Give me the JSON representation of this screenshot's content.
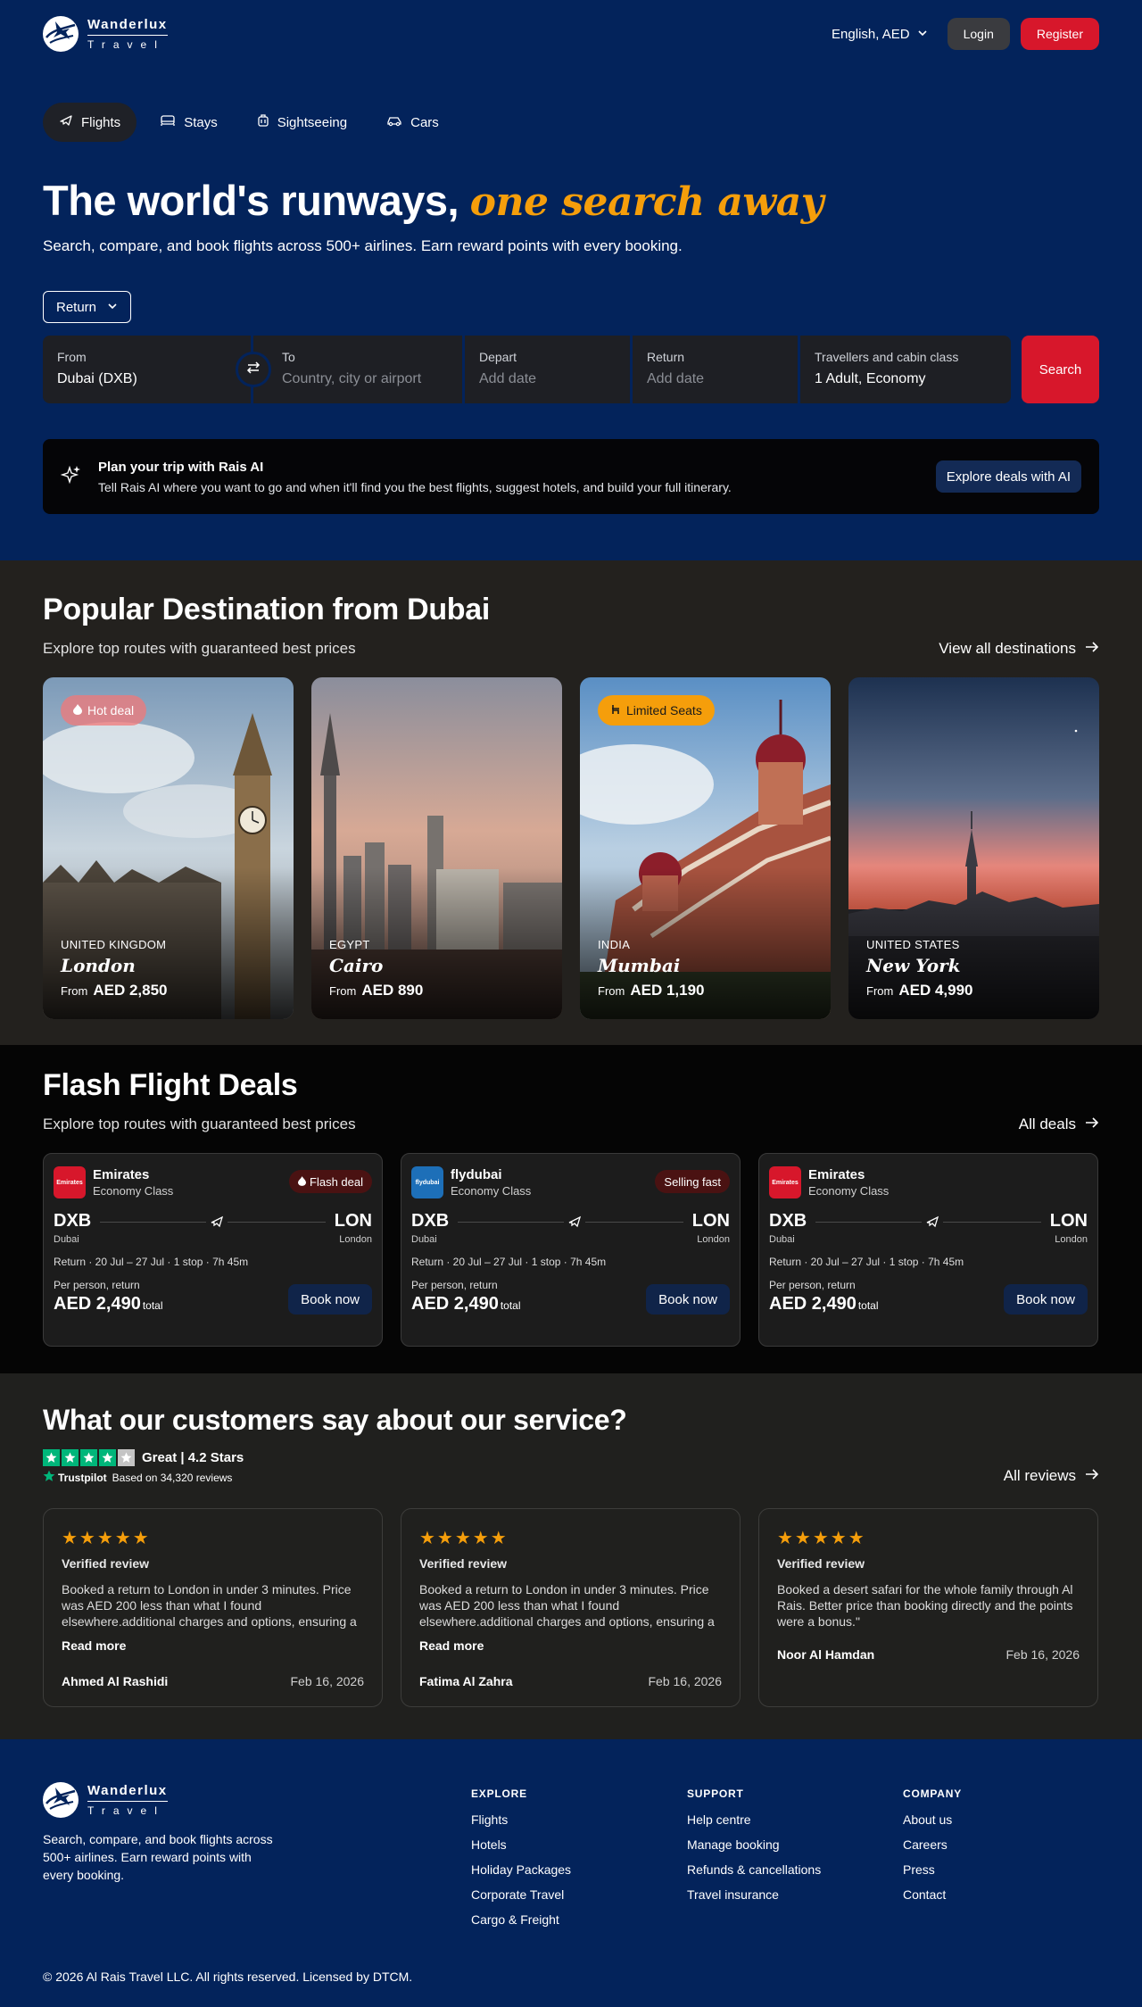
{
  "brand": {
    "name": "Wanderlux",
    "sub": "Travel"
  },
  "topbar": {
    "language": "English, AED",
    "login": "Login",
    "register": "Register"
  },
  "tabs": [
    {
      "label": "Flights",
      "icon": "plane-icon",
      "active": true
    },
    {
      "label": "Stays",
      "icon": "bed-icon"
    },
    {
      "label": "Sightseeing",
      "icon": "luggage-icon"
    },
    {
      "label": "Cars",
      "icon": "car-icon"
    }
  ],
  "hero": {
    "title": "The world's runways,",
    "title_accent": "one search away",
    "subtitle": "Search, compare, and book flights across 500+ airlines. Earn reward points with every booking."
  },
  "search": {
    "trip_type": "Return",
    "from_label": "From",
    "from_value": "Dubai (DXB)",
    "to_label": "To",
    "to_placeholder": "Country, city or airport",
    "depart_label": "Depart",
    "depart_placeholder": "Add date",
    "return_label": "Return",
    "return_placeholder": "Add date",
    "travellers_label": "Travellers and cabin class",
    "travellers_value": "1 Adult, Economy",
    "button": "Search"
  },
  "ai_banner": {
    "title": "Plan your trip with Rais AI",
    "desc": "Tell Rais AI where you want to go and when it'll find you the best flights, suggest hotels, and build your full itinerary.",
    "button": "Explore deals with AI"
  },
  "popular": {
    "title": "Popular Destination from Dubai",
    "subtitle": "Explore top routes with guaranteed best prices",
    "view_all": "View all destinations",
    "from_label": "From",
    "items": [
      {
        "country": "UNITED KINGDOM",
        "city": "London",
        "price": "AED 2,850",
        "badge": "Hot deal"
      },
      {
        "country": "EGYPT",
        "city": "Cairo",
        "price": "AED 890",
        "badge": ""
      },
      {
        "country": "INDIA",
        "city": "Mumbai",
        "price": "AED 1,190",
        "badge": "Limited Seats"
      },
      {
        "country": "UNITED STATES",
        "city": "New York",
        "price": "AED 4,990",
        "badge": ""
      }
    ]
  },
  "flash": {
    "title": "Flash Flight Deals",
    "subtitle": "Explore top routes with guaranteed best prices",
    "all_deals": "All deals",
    "per_person": "Per person, return",
    "total": "total",
    "book": "Book now",
    "deals": [
      {
        "airline": "Emirates",
        "logo_text": "Emirates",
        "cabin": "Economy Class",
        "badge": "Flash deal",
        "from": "DXB",
        "from_city": "Dubai",
        "to": "LON",
        "to_city": "London",
        "meta": "Return · 20 Jul – 27 Jul · 1 stop · 7h 45m",
        "price": "AED 2,490"
      },
      {
        "airline": "flydubai",
        "logo_text": "flydubai",
        "cabin": "Economy Class",
        "badge": "Selling fast",
        "from": "DXB",
        "from_city": "Dubai",
        "to": "LON",
        "to_city": "London",
        "meta": "Return · 20 Jul – 27 Jul · 1 stop · 7h 45m",
        "price": "AED 2,490"
      },
      {
        "airline": "Emirates",
        "logo_text": "Emirates",
        "cabin": "Economy Class",
        "badge": "",
        "from": "DXB",
        "from_city": "Dubai",
        "to": "LON",
        "to_city": "London",
        "meta": "Return · 20 Jul – 27 Jul · 1 stop · 7h 45m",
        "price": "AED 2,490"
      }
    ]
  },
  "reviews": {
    "title": "What our customers say about our service?",
    "rating_text": "Great | 4.2 Stars",
    "trustpilot": "Trustpilot",
    "based_on": "Based on 34,320 reviews",
    "all_reviews": "All reviews",
    "verified": "Verified review",
    "read_more": "Read more",
    "items": [
      {
        "stars": "★★★★★",
        "body": "Booked a return to London in under 3 minutes. Price was AED 200 less than what I found elsewhere.additional charges and options, ensuring a smooth experience.",
        "name": "Ahmed Al Rashidi",
        "date": "Feb 16, 2026",
        "more": true
      },
      {
        "stars": "★★★★★",
        "body": "Booked a return to London in under 3 minutes. Price was AED 200 less than what I found elsewhere.additional charges and options, ensuring a smooth experience.",
        "name": "Fatima Al Zahra",
        "date": "Feb 16, 2026",
        "more": true
      },
      {
        "stars": "★★★★★",
        "body": "Booked a desert safari for the whole family through Al Rais. Better price than booking directly and the points were a bonus.\"",
        "name": "Noor Al Hamdan",
        "date": "Feb 16, 2026",
        "more": false
      }
    ]
  },
  "footer": {
    "desc": "Search, compare, and book flights across 500+ airlines. Earn reward points with every booking.",
    "columns": [
      {
        "title": "EXPLORE",
        "links": [
          "Flights",
          "Hotels",
          "Holiday Packages",
          "Corporate Travel",
          "Cargo & Freight"
        ]
      },
      {
        "title": "SUPPORT",
        "links": [
          "Help centre",
          "Manage booking",
          "Refunds & cancellations",
          "Travel insurance"
        ]
      },
      {
        "title": "COMPANY",
        "links": [
          "About us",
          "Careers",
          "Press",
          "Contact"
        ]
      }
    ],
    "copyright": "© 2026 Al Rais Travel LLC. All rights reserved. Licensed by DTCM."
  },
  "colors": {
    "navy": "#03235b",
    "brand_red": "#d7172b",
    "accent_orange": "#f59e0b",
    "trustpilot_green": "#00b67a"
  }
}
